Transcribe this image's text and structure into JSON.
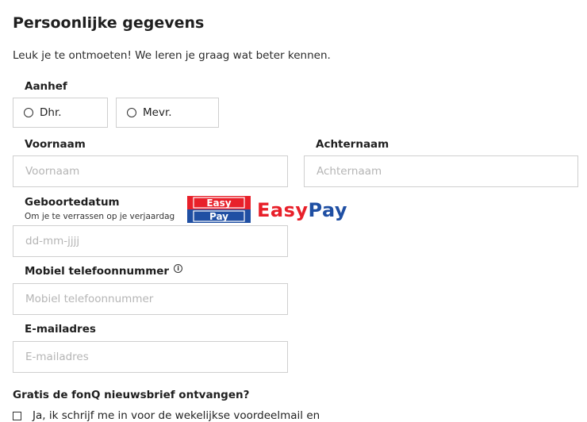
{
  "section": {
    "title": "Persoonlijke gegevens",
    "intro": "Leuk je te ontmoeten! We leren je graag wat beter kennen."
  },
  "salutation": {
    "label": "Aanhef",
    "options": [
      "Dhr.",
      "Mevr."
    ]
  },
  "first_name": {
    "label": "Voornaam",
    "placeholder": "Voornaam",
    "value": ""
  },
  "last_name": {
    "label": "Achternaam",
    "placeholder": "Achternaam",
    "value": ""
  },
  "birthdate": {
    "label": "Geboortedatum",
    "hint": "Om je te verrassen op je verjaardag",
    "placeholder": "dd-mm-jjjj"
  },
  "phone": {
    "label": "Mobiel telefoonnummer",
    "placeholder": "Mobiel telefoonnummer",
    "info_icon": "info-icon"
  },
  "email": {
    "label": "E-mailadres",
    "placeholder": "E-mailadres"
  },
  "newsletter": {
    "question": "Gratis de fonQ nieuwsbrief ontvangen?",
    "checkbox_label": "Ja, ik schrijf me in voor de wekelijkse voordeelmail en"
  },
  "overlay": {
    "logo_line1": "Easy",
    "logo_line2": "Pay",
    "brand_easy": "Easy",
    "brand_pay": "Pay",
    "colors": {
      "red": "#e8202a",
      "blue": "#1f4fa3"
    }
  }
}
